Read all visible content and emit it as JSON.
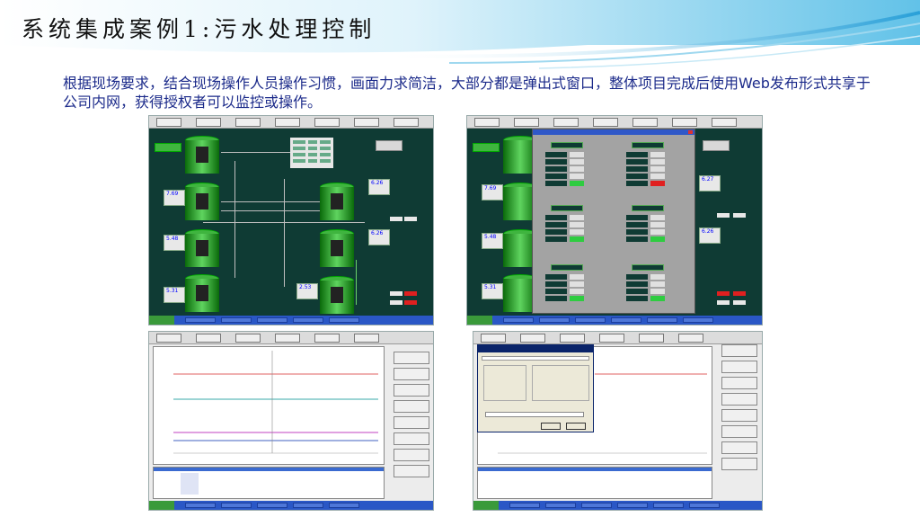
{
  "slide": {
    "title": "系统集成案例1:污水处理控制",
    "description": "根据现场要求，结合现场操作人员操作习惯，画面力求简洁，大部分都是弹出式窗口，整体项目完成后使用Web发布形式共享于公司内网，获得授权者可以监控或操作。"
  },
  "colors": {
    "scada_bg": "#0f3b34",
    "tank_green": "#3fb53f",
    "title_blue": "#1b2a8a",
    "taskbar_blue": "#2a57c6",
    "alarm_red": "#e02020"
  },
  "screens": [
    {
      "name": "process-overview",
      "readings": [
        "7.69",
        "5.48",
        "5.31",
        "6.26",
        "6.26",
        "2.53"
      ]
    },
    {
      "name": "popup-detail",
      "readings": [
        "7.69",
        "5.48",
        "5.31",
        "6.27",
        "6.26"
      ]
    },
    {
      "name": "trend-view",
      "side_button_count": 8
    },
    {
      "name": "trend-settings-dialog",
      "side_button_count": 8
    }
  ]
}
